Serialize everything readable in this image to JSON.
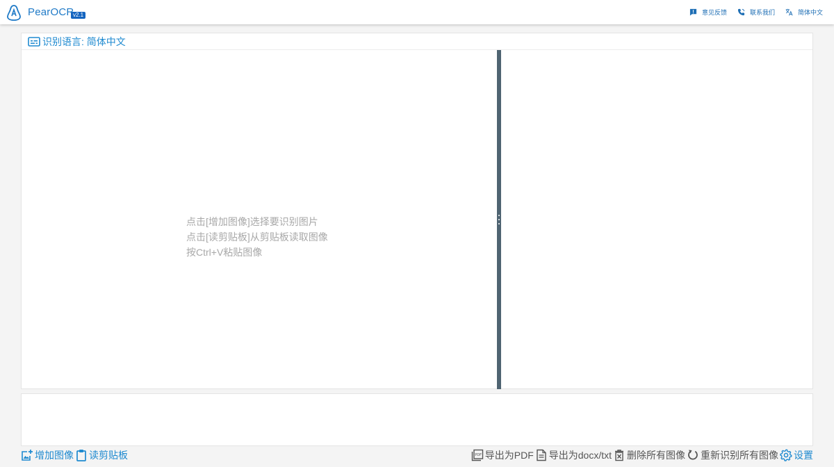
{
  "app": {
    "name": "PearOCR",
    "version": "v2.1"
  },
  "nav": {
    "feedback": "意见反馈",
    "contact": "联系我们",
    "language": "简体中文"
  },
  "recognition": {
    "language_label": "识别语言: 简体中文"
  },
  "hints": [
    "点击[增加图像]选择要识别图片",
    "点击[读剪贴板]从剪贴板读取图像",
    "按Ctrl+V粘贴图像"
  ],
  "toolbar": {
    "add_image": "增加图像",
    "read_clipboard": "读剪贴板",
    "export_pdf": "导出为PDF",
    "export_docx": "导出为docx/txt",
    "delete_all": "删除所有图像",
    "rerecognize_all": "重新识别所有图像",
    "settings": "设置"
  },
  "colors": {
    "accent": "#1f8ad0",
    "brand": "#1f7ac7",
    "splitter": "#4f6472",
    "hint_text": "#a8a8a8"
  },
  "icons": {
    "logo": "pear-logo-icon",
    "feedback": "feedback-icon",
    "contact": "phone-icon",
    "language": "translate-icon",
    "language_bar": "keyboard-subtitle-icon",
    "add_image": "add-image-icon",
    "read_clipboard": "clipboard-icon",
    "export_pdf": "pdf-icon",
    "export_docx": "document-icon",
    "delete_all": "delete-icon",
    "rerecognize_all": "refresh-icon",
    "settings": "gear-icon"
  }
}
